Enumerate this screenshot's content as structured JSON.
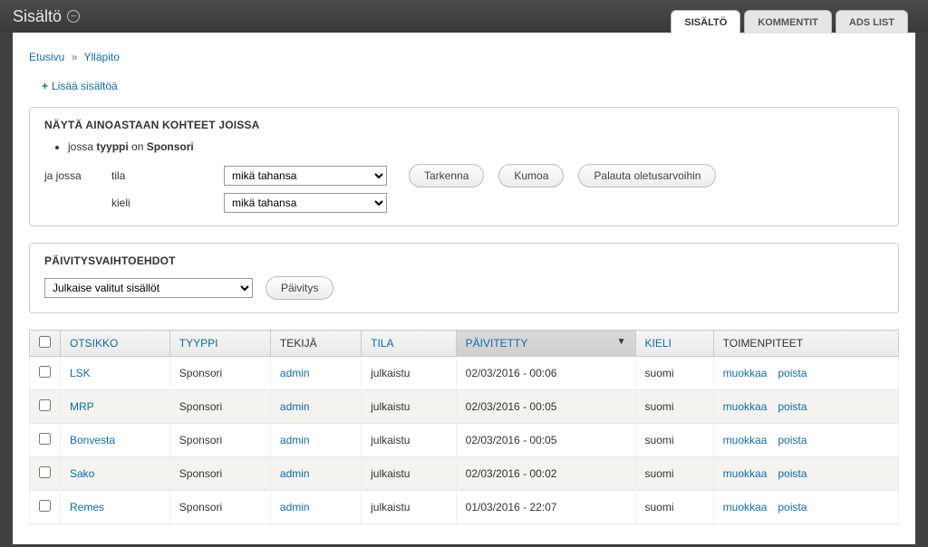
{
  "topbar": {
    "title": "Sisältö",
    "tabs": [
      {
        "label": "SISÄLTÖ",
        "active": true
      },
      {
        "label": "KOMMENTIT",
        "active": false
      },
      {
        "label": "ADS LIST",
        "active": false
      }
    ]
  },
  "breadcrumb": {
    "home": "Etusivu",
    "sep": "»",
    "current": "Ylläpito"
  },
  "add_content": {
    "label": "Lisää sisältöä"
  },
  "filters": {
    "panel_title": "NÄYTÄ AINOASTAAN KOHTEET JOISSA",
    "criteria_prefix": "jossa",
    "criteria_field": "tyyppi",
    "criteria_verb": "on",
    "criteria_value": "Sponsori",
    "and_where": "ja jossa",
    "rows": [
      {
        "label": "tila",
        "selected": "mikä tahansa"
      },
      {
        "label": "kieli",
        "selected": "mikä tahansa"
      }
    ],
    "buttons": {
      "refine": "Tarkenna",
      "undo": "Kumoa",
      "reset": "Palauta oletusarvoihin"
    }
  },
  "bulk": {
    "panel_title": "PÄIVITYSVAIHTOEHDOT",
    "action_selected": "Julkaise valitut sisällöt",
    "apply": "Päivitys"
  },
  "table": {
    "headers": {
      "title": "OTSIKKO",
      "type": "TYYPPI",
      "author": "TEKIJÄ",
      "state": "TILA",
      "updated": "PÄIVITETTY",
      "lang": "KIELI",
      "ops": "TOIMENPITEET"
    },
    "op_labels": {
      "edit": "muokkaa",
      "delete": "poista"
    },
    "rows": [
      {
        "title": "LSK",
        "type": "Sponsori",
        "author": "admin",
        "state": "julkaistu",
        "updated": "02/03/2016 - 00:06",
        "lang": "suomi"
      },
      {
        "title": "MRP",
        "type": "Sponsori",
        "author": "admin",
        "state": "julkaistu",
        "updated": "02/03/2016 - 00:05",
        "lang": "suomi"
      },
      {
        "title": "Bonvesta",
        "type": "Sponsori",
        "author": "admin",
        "state": "julkaistu",
        "updated": "02/03/2016 - 00:05",
        "lang": "suomi"
      },
      {
        "title": "Sako",
        "type": "Sponsori",
        "author": "admin",
        "state": "julkaistu",
        "updated": "02/03/2016 - 00:02",
        "lang": "suomi"
      },
      {
        "title": "Remes",
        "type": "Sponsori",
        "author": "admin",
        "state": "julkaistu",
        "updated": "01/03/2016 - 22:07",
        "lang": "suomi"
      }
    ]
  }
}
